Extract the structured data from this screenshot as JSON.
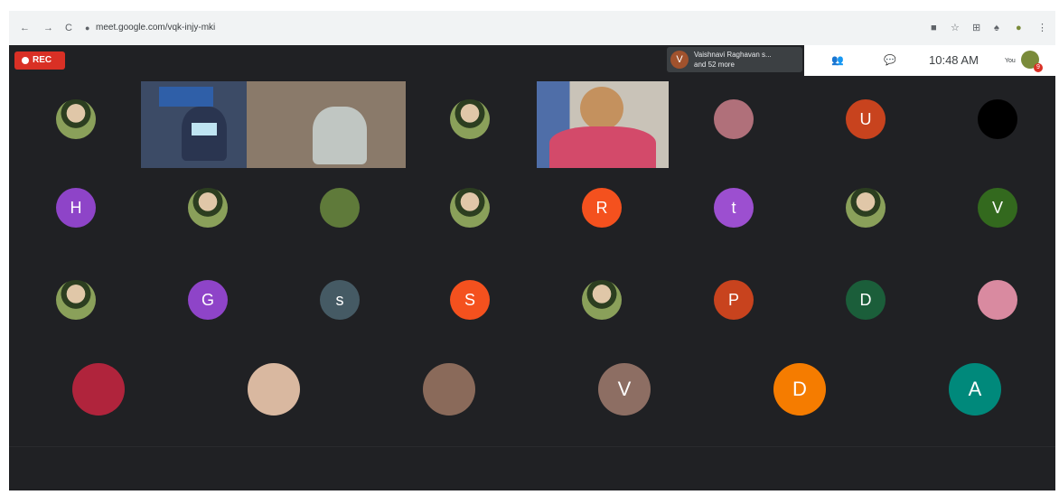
{
  "browser": {
    "back": "←",
    "forward": "→",
    "reload": "C",
    "url": "meet.google.com/vqk-injy-mki"
  },
  "meet": {
    "rec_label": "REC",
    "presenter_initial": "V",
    "presenter_line1": "Vaishnavi Raghavan s...",
    "presenter_line2": "and 52 more",
    "clock": "10:48 AM",
    "you_label": "You",
    "badge_count": "9"
  },
  "row1": [
    "",
    "",
    "U",
    ""
  ],
  "row2": [
    "H",
    "",
    "",
    "",
    "R",
    "t",
    "",
    "V"
  ],
  "row3": [
    "",
    "G",
    "s",
    "S",
    "",
    "P",
    "D",
    ""
  ],
  "row4": [
    "",
    "",
    "",
    "V",
    "D",
    "A"
  ],
  "colors": {
    "U": "#c8431e",
    "H": "#8e44c8",
    "R": "#f4511e",
    "t": "#9c4fd0",
    "V_green": "#33691e",
    "G": "#8e44c8",
    "s": "#455a64",
    "S": "#f4511e",
    "P": "#c8431e",
    "D_dark": "#1b5e3a",
    "V_brown": "#8d6e63",
    "D_orange": "#f57c00",
    "A": "#00897b"
  }
}
